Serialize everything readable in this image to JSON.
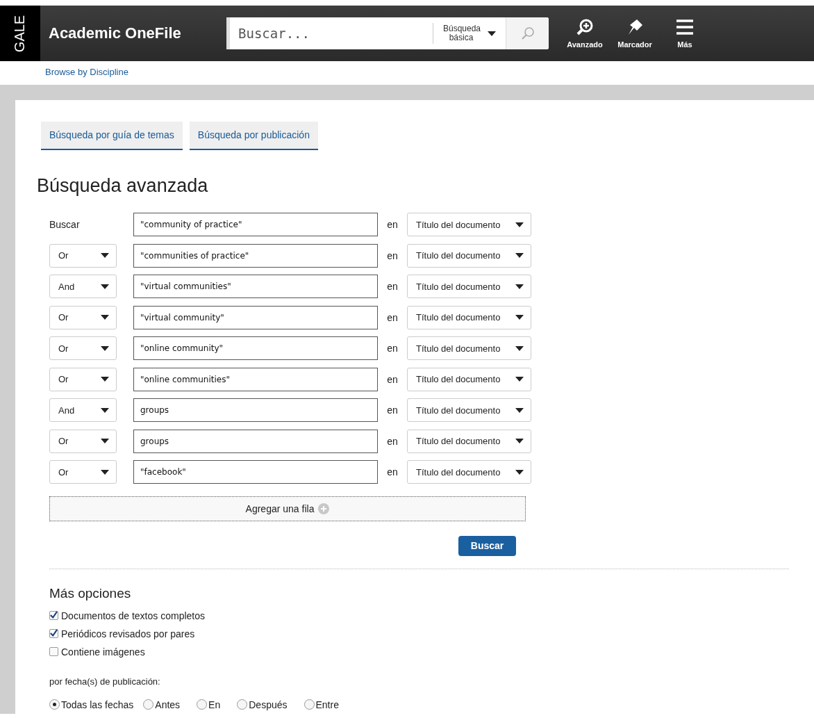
{
  "header": {
    "brand": "GALE",
    "product": "Academic OneFile",
    "search": {
      "placeholder": "Buscar...",
      "mode": "Búsqueda básica"
    },
    "actions": [
      {
        "kind": "advanced",
        "label": "Avanzado"
      },
      {
        "kind": "bookmark",
        "label": "Marcador"
      },
      {
        "kind": "menu",
        "label": "Más"
      }
    ]
  },
  "browse_link": "Browse by Discipline",
  "tabs": [
    {
      "label": "Búsqueda por guía de temas",
      "selected": false
    },
    {
      "label": "Búsqueda por publicación",
      "selected": false
    }
  ],
  "title": "Búsqueda avanzada",
  "rows": [
    {
      "kind": "label",
      "operator": "Buscar",
      "term": "\"community of practice\"",
      "in": "en",
      "field": "Título del documento"
    },
    {
      "kind": "select",
      "operator": "Or",
      "term": "\"communities of practice\"",
      "in": "en",
      "field": "Título del documento"
    },
    {
      "kind": "select",
      "operator": "And",
      "term": "\"virtual communities\"",
      "in": "en",
      "field": "Título del documento"
    },
    {
      "kind": "select",
      "operator": "Or",
      "term": "\"virtual community\"",
      "in": "en",
      "field": "Título del documento"
    },
    {
      "kind": "select",
      "operator": "Or",
      "term": "\"online community\"",
      "in": "en",
      "field": "Título del documento"
    },
    {
      "kind": "select",
      "operator": "Or",
      "term": "\"online communities\"",
      "in": "en",
      "field": "Título del documento"
    },
    {
      "kind": "select",
      "operator": "And",
      "term": "groups",
      "in": "en",
      "field": "Título del documento"
    },
    {
      "kind": "select",
      "operator": "Or",
      "term": "groups",
      "in": "en",
      "field": "Título del documento"
    },
    {
      "kind": "select",
      "operator": "Or",
      "term": "\"facebook\"",
      "in": "en",
      "field": "Título del documento"
    }
  ],
  "add_row": "Agregar una fila",
  "search_button": "Buscar",
  "more_options": {
    "title": "Más opciones",
    "checkboxes": [
      {
        "label": "Documentos de textos completos",
        "checked": true
      },
      {
        "label": "Periódicos revisados por pares",
        "checked": true
      },
      {
        "label": "Contiene imágenes",
        "checked": false
      }
    ],
    "date_label": "por fecha(s) de publicación:",
    "date_options": [
      {
        "label": "Todas las fechas",
        "selected": true
      },
      {
        "label": "Antes",
        "selected": false
      },
      {
        "label": "En",
        "selected": false
      },
      {
        "label": "Después",
        "selected": false
      },
      {
        "label": "Entre",
        "selected": false
      }
    ]
  }
}
